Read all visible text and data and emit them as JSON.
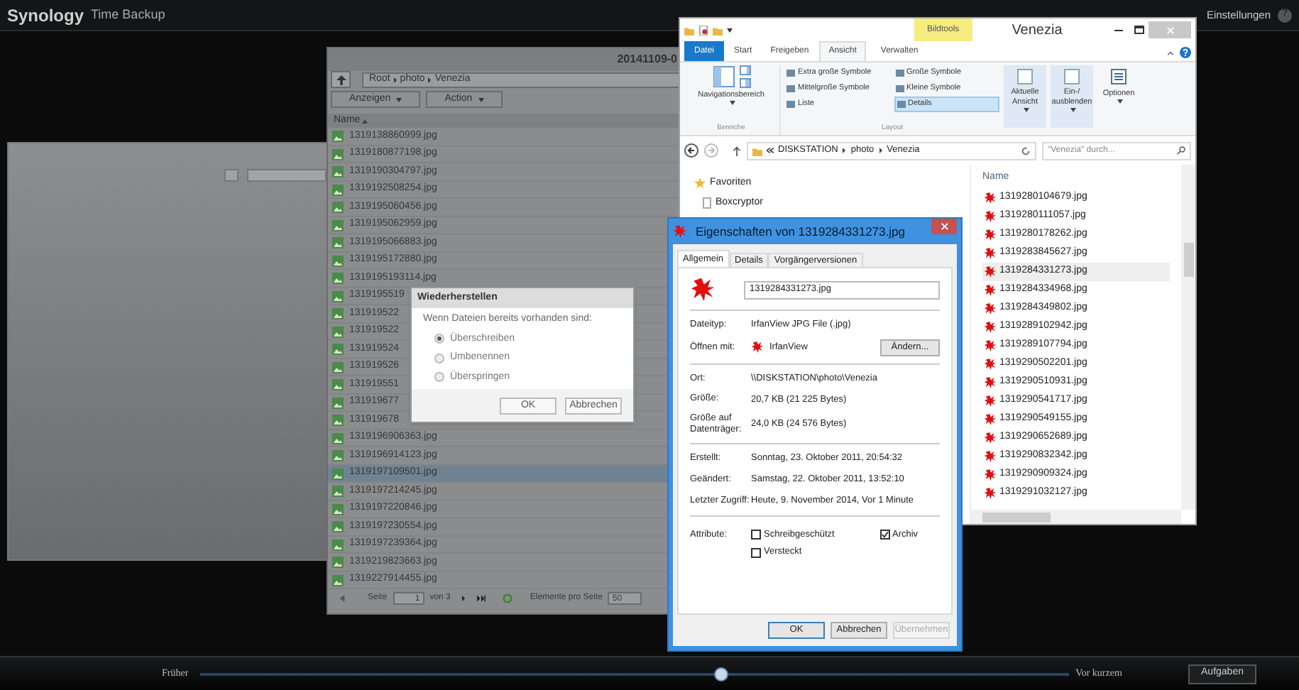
{
  "app": {
    "logo": "Synology",
    "title": "Time Backup",
    "settings": "Einstellungen",
    "help": "?"
  },
  "timeline": {
    "earlier": "Früher",
    "recent": "Vor kurzem",
    "level": 0.6,
    "tasks": "Aufgaben"
  },
  "backup_browser": {
    "date": "20141109-0",
    "path": [
      "Root",
      "photo",
      "Venezia"
    ],
    "view_menu": "Anzeigen",
    "action_menu": "Action",
    "column": "Name",
    "files": [
      {
        "name": "1319138860999.jpg",
        "selected": false
      },
      {
        "name": "1319180877198.jpg",
        "selected": false
      },
      {
        "name": "1319190304797.jpg",
        "selected": false
      },
      {
        "name": "1319192508254.jpg",
        "selected": false
      },
      {
        "name": "1319195060456.jpg",
        "selected": false
      },
      {
        "name": "1319195062959.jpg",
        "selected": false
      },
      {
        "name": "1319195066883.jpg",
        "selected": false
      },
      {
        "name": "1319195172880.jpg",
        "selected": false
      },
      {
        "name": "1319195193114.jpg",
        "selected": false
      },
      {
        "name": "1319195519",
        "selected": false
      },
      {
        "name": "131919522",
        "selected": false
      },
      {
        "name": "131919522",
        "selected": false
      },
      {
        "name": "131919524",
        "selected": false
      },
      {
        "name": "131919526",
        "selected": false
      },
      {
        "name": "131919551",
        "selected": false
      },
      {
        "name": "131919677",
        "selected": false
      },
      {
        "name": "131919678",
        "selected": false
      },
      {
        "name": "1319196906363.jpg",
        "selected": false
      },
      {
        "name": "1319196914123.jpg",
        "selected": false
      },
      {
        "name": "1319197109501.jpg",
        "selected": true
      },
      {
        "name": "1319197214245.jpg",
        "selected": false
      },
      {
        "name": "1319197220846.jpg",
        "selected": false
      },
      {
        "name": "1319197230554.jpg",
        "selected": false
      },
      {
        "name": "1319197239364.jpg",
        "selected": false
      },
      {
        "name": "1319219823663.jpg",
        "selected": false
      },
      {
        "name": "1319227914455.jpg",
        "selected": false
      }
    ],
    "pager": {
      "page_label": "Seite",
      "page": "1",
      "of": "von 3",
      "per_page_label": "Elemente pro Seite",
      "per_page": "50"
    }
  },
  "restore_dialog": {
    "title": "Wiederherstellen",
    "prompt": "Wenn Dateien bereits vorhanden sind:",
    "options": [
      {
        "label": "Überschreiben",
        "selected": true
      },
      {
        "label": "Umbenennen",
        "selected": false
      },
      {
        "label": "Überspringen",
        "selected": false
      }
    ],
    "buttons": [
      "OK",
      "Abbrechen"
    ]
  },
  "explorer": {
    "title": "Venezia",
    "context_tab": "Bildtools",
    "tabs": [
      {
        "label": "Datei",
        "kind": "file",
        "selected": false
      },
      {
        "label": "Start",
        "kind": "tab",
        "selected": false
      },
      {
        "label": "Freigeben",
        "kind": "tab",
        "selected": false
      },
      {
        "label": "Ansicht",
        "kind": "tab",
        "selected": true
      },
      {
        "label": "Verwalten",
        "kind": "tab",
        "selected": false
      }
    ],
    "nav_pane_button": "Navigationsbereich",
    "group_panes": "Bereiche",
    "group_layout": "Layout",
    "layouts": [
      {
        "label": "Extra große Symbole",
        "selected": false
      },
      {
        "label": "Große Symbole",
        "selected": false
      },
      {
        "label": "Mittelgroße Symbole",
        "selected": false
      },
      {
        "label": "Kleine Symbole",
        "selected": false
      },
      {
        "label": "Liste",
        "selected": false
      },
      {
        "label": "Details",
        "selected": true
      }
    ],
    "current_view": [
      "Aktuelle",
      "Ansicht"
    ],
    "show_hide": [
      "Ein-/",
      "ausblenden"
    ],
    "options": "Optionen",
    "path": [
      "DISKSTATION",
      "photo",
      "Venezia"
    ],
    "search": {
      "placeholder": "\"Venezia\" durch..."
    },
    "nav": [
      {
        "label": "Favoriten",
        "kind": "favorites"
      },
      {
        "label": "Boxcryptor",
        "kind": "file"
      }
    ],
    "column": "Name",
    "files": [
      {
        "name": "1319280104679.jpg",
        "selected": false
      },
      {
        "name": "1319280111057.jpg",
        "selected": false
      },
      {
        "name": "1319280178262.jpg",
        "selected": false
      },
      {
        "name": "1319283845627.jpg",
        "selected": false
      },
      {
        "name": "1319284331273.jpg",
        "selected": true
      },
      {
        "name": "1319284334968.jpg",
        "selected": false
      },
      {
        "name": "1319284349802.jpg",
        "selected": false
      },
      {
        "name": "1319289102942.jpg",
        "selected": false
      },
      {
        "name": "1319289107794.jpg",
        "selected": false
      },
      {
        "name": "1319290502201.jpg",
        "selected": false
      },
      {
        "name": "1319290510931.jpg",
        "selected": false
      },
      {
        "name": "1319290541717.jpg",
        "selected": false
      },
      {
        "name": "1319290549155.jpg",
        "selected": false
      },
      {
        "name": "1319290652689.jpg",
        "selected": false
      },
      {
        "name": "1319290832342.jpg",
        "selected": false
      },
      {
        "name": "1319290909324.jpg",
        "selected": false
      },
      {
        "name": "1319291032127.jpg",
        "selected": false
      }
    ]
  },
  "properties": {
    "title": "Eigenschaften von 1319284331273.jpg",
    "tabs": [
      {
        "label": "Allgemein",
        "selected": true
      },
      {
        "label": "Details",
        "selected": false
      },
      {
        "label": "Vorgängerversionen",
        "selected": false
      }
    ],
    "filename": "1319284331273.jpg",
    "sections": [
      [
        {
          "label": "Dateityp:",
          "value": "IrfanView JPG File (.jpg)",
          "kind": "text"
        },
        {
          "label": "Öffnen mit:",
          "value": "IrfanView",
          "kind": "app",
          "button": "Ändern..."
        }
      ],
      [
        {
          "label": "Ort:",
          "value": "\\\\DISKSTATION\\photo\\Venezia",
          "kind": "text"
        },
        {
          "label": "Größe:",
          "value": "20,7 KB (21 225 Bytes)",
          "kind": "text"
        },
        {
          "label": "Größe auf Datenträger:",
          "value": "24,0 KB (24 576 Bytes)",
          "kind": "text"
        }
      ],
      [
        {
          "label": "Erstellt:",
          "value": "Sonntag, 23. Oktober 2011, 20:54:32",
          "kind": "text"
        },
        {
          "label": "Geändert:",
          "value": "Samstag, 22. Oktober 2011, 13:52:10",
          "kind": "text"
        },
        {
          "label": "Letzter Zugriff:",
          "value": "Heute, 9. November 2014, Vor 1 Minute",
          "kind": "text"
        }
      ]
    ],
    "attributes_label": "Attribute:",
    "attributes": [
      {
        "label": "Schreibgeschützt",
        "checked": false
      },
      {
        "label": "Archiv",
        "checked": true
      },
      {
        "label": "Versteckt",
        "checked": false
      }
    ],
    "buttons": [
      {
        "label": "OK",
        "disabled": false,
        "default": true
      },
      {
        "label": "Abbrechen",
        "disabled": false,
        "default": false
      },
      {
        "label": "Übernehmen",
        "disabled": true,
        "default": false
      }
    ]
  }
}
